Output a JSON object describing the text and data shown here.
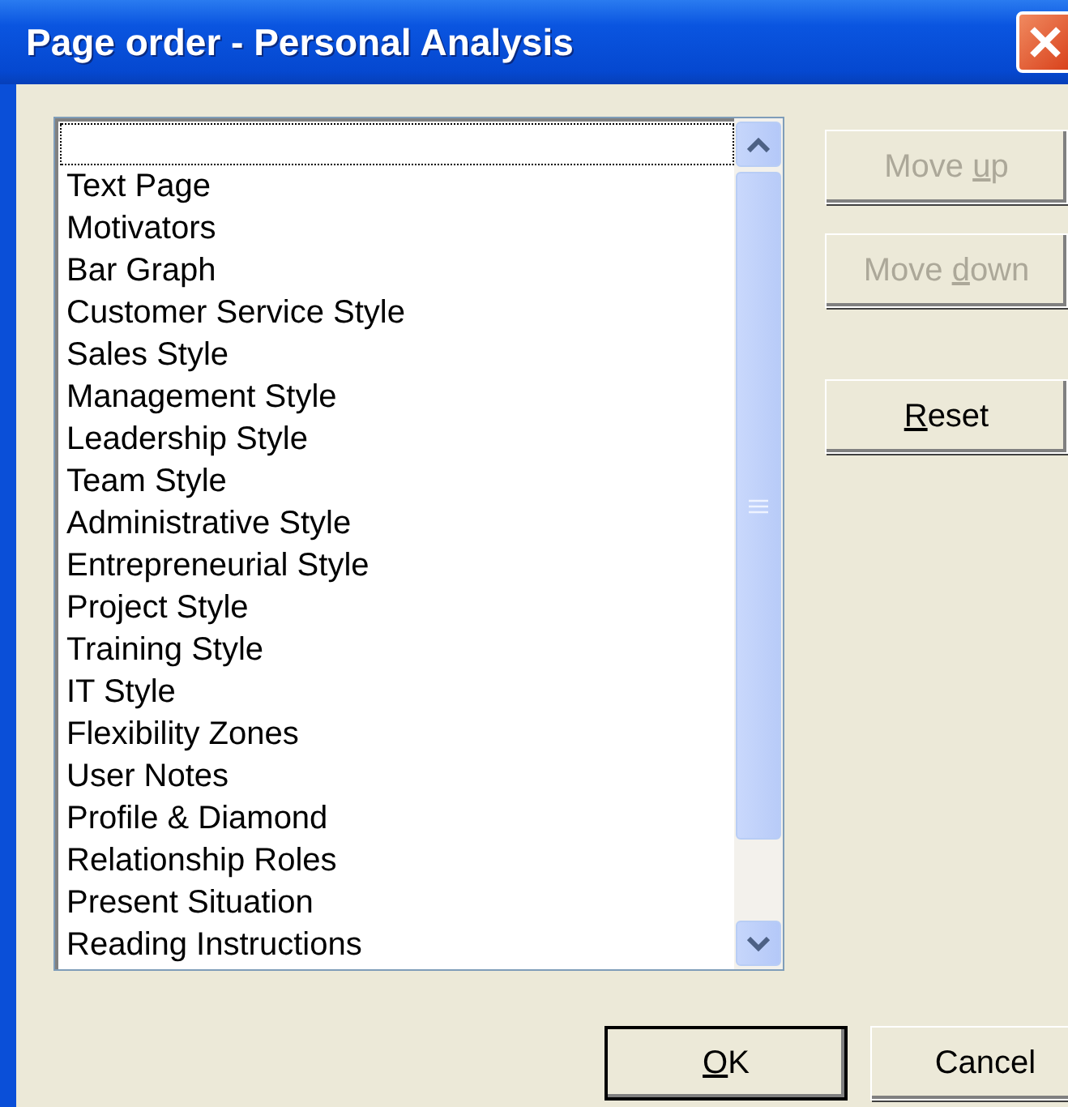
{
  "window": {
    "title": "Page order - Personal Analysis"
  },
  "list": {
    "items": [
      {
        "focused": true
      },
      {
        "label": "Text Page",
        "focused": false
      },
      {
        "label": "Motivators",
        "focused": false
      },
      {
        "label": "Bar Graph",
        "focused": false
      },
      {
        "label": "Customer Service Style",
        "focused": false
      },
      {
        "label": "Sales Style",
        "focused": false
      },
      {
        "label": "Management Style",
        "focused": false
      },
      {
        "label": "Leadership Style",
        "focused": false
      },
      {
        "label": "Team Style",
        "focused": false
      },
      {
        "label": "Administrative Style",
        "focused": false
      },
      {
        "label": "Entrepreneurial Style",
        "focused": false
      },
      {
        "label": "Project Style",
        "focused": false
      },
      {
        "label": "Training Style",
        "focused": false
      },
      {
        "label": "IT Style",
        "focused": false
      },
      {
        "label": "Flexibility Zones",
        "focused": false
      },
      {
        "label": "User Notes",
        "focused": false
      },
      {
        "label": "Profile & Diamond",
        "focused": false
      },
      {
        "label": "Relationship Roles",
        "focused": false
      },
      {
        "label": "Present Situation",
        "focused": false
      },
      {
        "label": "Reading Instructions",
        "focused": false
      }
    ]
  },
  "side_buttons": [
    {
      "label": [
        {
          "text": "Move ",
          "underlined": false
        },
        {
          "text": "u",
          "underlined": true
        },
        {
          "text": "p",
          "underlined": false
        }
      ],
      "disabled": true
    },
    {
      "label": [
        {
          "text": "Move ",
          "underlined": false
        },
        {
          "text": "d",
          "underlined": true
        },
        {
          "text": "own",
          "underlined": false
        }
      ],
      "disabled": true
    },
    {
      "label": [
        {
          "text": "R",
          "underlined": true
        },
        {
          "text": "eset",
          "underlined": false
        }
      ],
      "disabled": false
    }
  ],
  "footer_buttons": [
    {
      "label": [
        {
          "text": "O",
          "underlined": true
        },
        {
          "text": "K",
          "underlined": false
        }
      ],
      "default": true
    },
    {
      "label": [
        {
          "text": "Cancel",
          "underlined": false
        }
      ],
      "default": false
    }
  ]
}
